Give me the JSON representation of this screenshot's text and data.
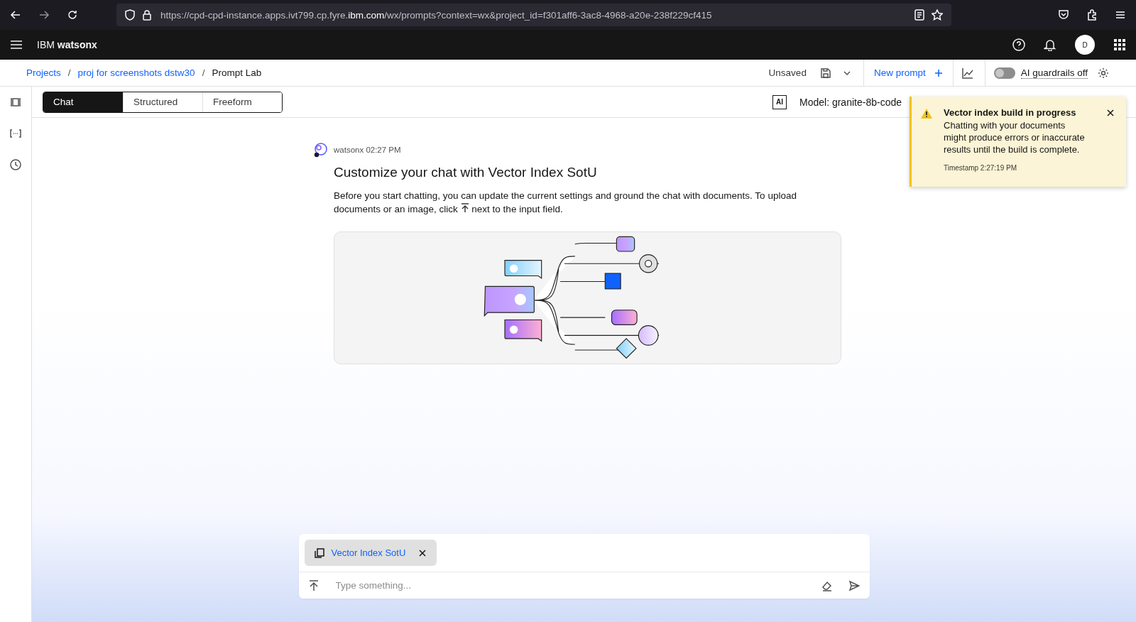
{
  "browser": {
    "url": "https://cpd-cpd-instance.apps.ivt799.cp.fyre.**ibm.com**/wx/prompts?context=wx&project_id=f301aff6-3ac8-4968-a20e-238f229cf415"
  },
  "header": {
    "brand": "IBM",
    "product": "watsonx",
    "avatar": "D"
  },
  "breadcrumbs": [
    {
      "label": "Projects",
      "link": true,
      "separator": "/"
    },
    {
      "label": "proj for screenshots dstw30",
      "link": true,
      "separator": "/"
    },
    {
      "label": "Prompt Lab",
      "link": false
    }
  ],
  "toolbar": {
    "status": "Unsaved",
    "new_prompt": "New prompt",
    "guardrails": {
      "label": "AI guardrails off",
      "on": false
    }
  },
  "tabs": [
    {
      "label": "Chat",
      "selected": true
    },
    {
      "label": "Structured",
      "selected": false
    },
    {
      "label": "Freeform",
      "selected": false
    }
  ],
  "model": {
    "badge": "AI",
    "label": "Model: granite-8b-code"
  },
  "message": {
    "sender": "watsonx 02:27 PM",
    "title": "Customize your chat with Vector Index SotU",
    "body_before": "Before you start chatting, you can update the current settings and ground the chat with documents. To upload documents or an image, click",
    "body_after": "next to the input field."
  },
  "composer": {
    "chip": "Vector Index SotU",
    "placeholder": "Type something..."
  },
  "toast": {
    "title": "Vector index build in progress",
    "body": "Chatting with your documents might produce errors or inaccurate results until the build is complete.",
    "timestamp": "Timestamp 2:27:19 PM"
  }
}
